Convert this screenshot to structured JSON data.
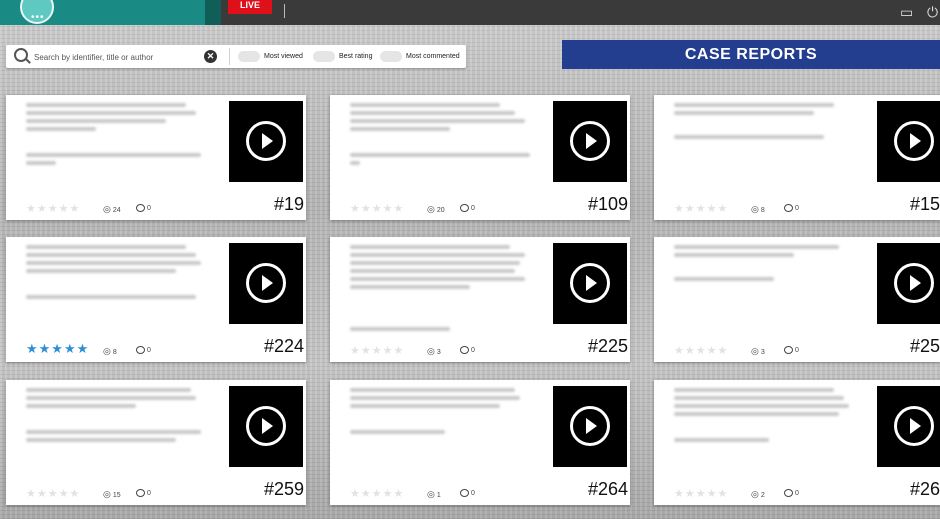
{
  "topbar": {
    "logo_dots": "•••",
    "live_label": "LIVE",
    "tv_icon": "▭",
    "plug_icon": "⏻"
  },
  "search": {
    "placeholder": "Search by identifier, title or author",
    "clear_glyph": "✕"
  },
  "filters": [
    {
      "label": "Most viewed"
    },
    {
      "label": "Best rating"
    },
    {
      "label": "Most commented"
    }
  ],
  "section_title": "CASE REPORTS",
  "colors": {
    "header_blue": "#233d8f",
    "accent_teal": "#1a8a84",
    "live_red": "#e0101a",
    "star_blue": "#2f8fd6"
  },
  "cards": [
    {
      "number": "#19",
      "stars": "★★★★★",
      "rating": 0,
      "views": "24",
      "comments": "0"
    },
    {
      "number": "#109",
      "stars": "★★★★★",
      "rating": 0,
      "views": "20",
      "comments": "0"
    },
    {
      "number": "#15",
      "stars": "★★★★★",
      "rating": 0,
      "views": "8",
      "comments": "0"
    },
    {
      "number": "#224",
      "stars": "★★★★★",
      "rating": 5,
      "views": "8",
      "comments": "0"
    },
    {
      "number": "#225",
      "stars": "★★★★★",
      "rating": 0,
      "views": "3",
      "comments": "0"
    },
    {
      "number": "#25",
      "stars": "★★★★★",
      "rating": 0,
      "views": "3",
      "comments": "0"
    },
    {
      "number": "#259",
      "stars": "★★★★★",
      "rating": 0,
      "views": "15",
      "comments": "0"
    },
    {
      "number": "#264",
      "stars": "★★★★★",
      "rating": 0,
      "views": "1",
      "comments": "0"
    },
    {
      "number": "#26",
      "stars": "★★★★★",
      "rating": 0,
      "views": "2",
      "comments": "0"
    }
  ]
}
